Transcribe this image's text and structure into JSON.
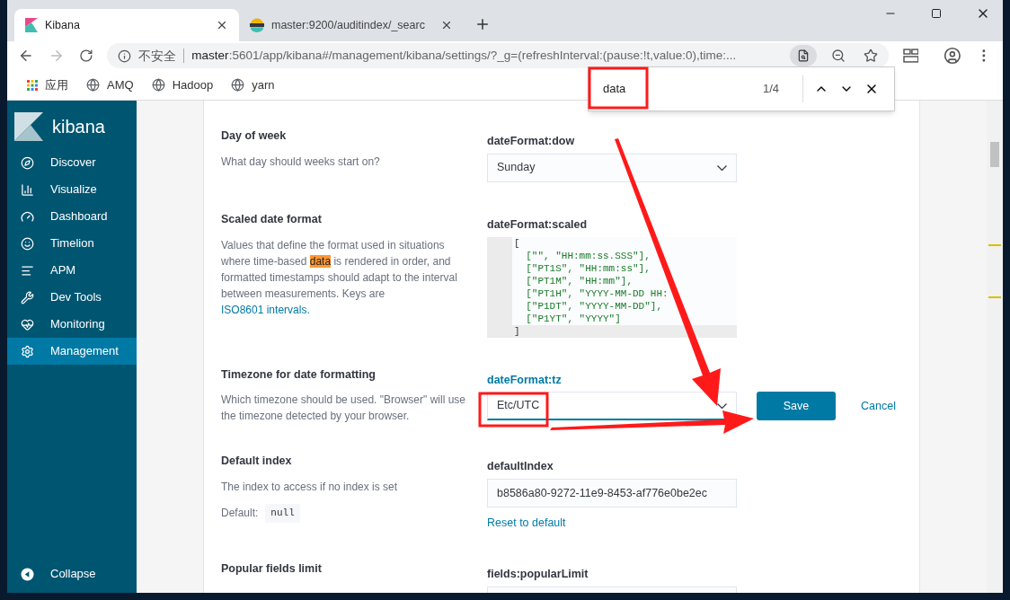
{
  "browser": {
    "tabs": [
      {
        "title": "Kibana",
        "selected": true
      },
      {
        "title": "master:9200/auditindex/_searc",
        "selected": false
      }
    ],
    "address": {
      "security": "不安全",
      "host": "master",
      "path": ":5601/app/kibana#/management/kibana/settings/?_g=(refreshInterval:(pause:!t,value:0),time:..."
    },
    "bookmarks": [
      "应用",
      "AMQ",
      "Hadoop",
      "yarn"
    ],
    "find_bar": {
      "query": "data",
      "count": "1/4"
    }
  },
  "sidebar": {
    "logo": "kibana",
    "items": [
      {
        "label": "Discover",
        "selected": false
      },
      {
        "label": "Visualize",
        "selected": false
      },
      {
        "label": "Dashboard",
        "selected": false
      },
      {
        "label": "Timelion",
        "selected": false
      },
      {
        "label": "APM",
        "selected": false
      },
      {
        "label": "Dev Tools",
        "selected": false
      },
      {
        "label": "Monitoring",
        "selected": false
      },
      {
        "label": "Management",
        "selected": true
      }
    ],
    "collapse": "Collapse"
  },
  "settings": [
    {
      "kind": "select",
      "title": "Day of week",
      "description": [
        {
          "kind": "plain",
          "text": "What day should weeks start on?"
        }
      ],
      "key": "dateFormat:dow",
      "value": "Sunday"
    },
    {
      "kind": "code",
      "title": "Scaled date format",
      "description": [
        {
          "kind": "plain",
          "text": "Values that define the format used in situations where time-based "
        },
        {
          "kind": "highlight",
          "text": "data"
        },
        {
          "kind": "plain",
          "text": " is rendered in order, and formatted timestamps should adapt to the interval between measurements. Keys are "
        },
        {
          "kind": "link",
          "text": "ISO8601 intervals."
        }
      ],
      "key": "dateFormat:scaled",
      "lines": [
        "[",
        "  [\"\", \"HH:mm:ss.SSS\"],",
        "  [\"PT1S\", \"HH:mm:ss\"],",
        "  [\"PT1M\", \"HH:mm\"],",
        "  [\"PT1H\", \"YYYY-MM-DD HH:",
        "  [\"P1DT\", \"YYYY-MM-DD\"],",
        "  [\"P1YT\", \"YYYY\"]",
        "]"
      ]
    },
    {
      "kind": "select",
      "title": "Timezone for date formatting",
      "description": [
        {
          "kind": "plain",
          "text": "Which timezone should be used. \"Browser\" will use the timezone detected by your browser."
        }
      ],
      "key": "dateFormat:tz",
      "value": "Etc/UTC",
      "edited": true,
      "save": "Save",
      "cancel": "Cancel"
    },
    {
      "kind": "text",
      "title": "Default index",
      "description": [
        {
          "kind": "plain",
          "text": "The index to access if no index is set"
        }
      ],
      "default_label": "Default:",
      "default_value": "null",
      "key": "defaultIndex",
      "value": "b8586a80-9272-11e9-8453-af776e0be2ec",
      "reset": "Reset to default"
    },
    {
      "kind": "partial",
      "title": "Popular fields limit",
      "key": "fields:popularLimit"
    }
  ]
}
